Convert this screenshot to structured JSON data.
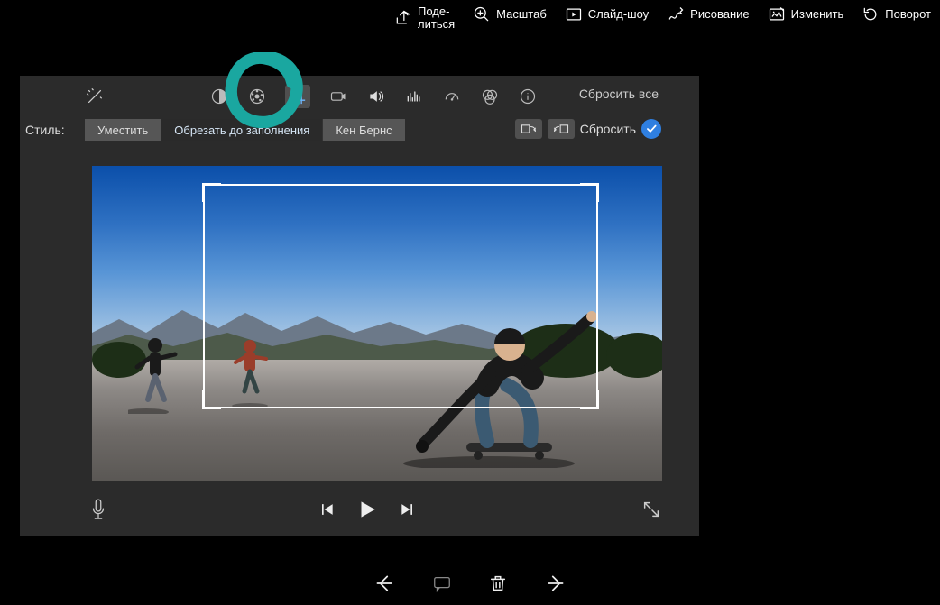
{
  "topbar": {
    "share": "Поде-\nлиться",
    "zoom": "Масштаб",
    "slideshow": "Слайд-шоу",
    "draw": "Рисование",
    "edit": "Изменить",
    "rotate": "Поворот"
  },
  "toolbar": {
    "resetAll": "Сбросить все"
  },
  "stylebar": {
    "label": "Стиль:",
    "fit": "Уместить",
    "crop": "Обрезать до заполнения",
    "kenburns": "Кен Бернс",
    "reset": "Сбросить"
  }
}
